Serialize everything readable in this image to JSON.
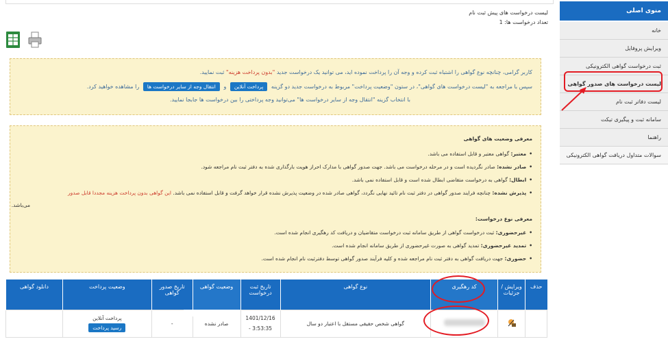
{
  "sidebar": {
    "header": "منوی اصلی",
    "items": [
      "خانه",
      "ویرایش پروفایل",
      "ثبت درخواست گواهی الکترونیکی",
      "لیست درخواست های صدور گواهی",
      "لیست دفاتر ثبت نام",
      "سامانه ثبت و پیگیری تیکت",
      "راهنما",
      "سوالات متداول دریافت گواهی الکترونیکی"
    ]
  },
  "page": {
    "title": "لیست درخواست های پیش ثبت نام",
    "count": "تعداد درخواست ها: 1"
  },
  "tools": {
    "excel_icon": "excel-icon",
    "print_icon": "printer-icon"
  },
  "notice": {
    "line1_a": "کاربر گرامی، چنانچه نوع گواهی را اشتباه ثبت کرده و وجه آن را پرداخت نموده اید، می توانید یک درخواست جدید",
    "line1_b": "\"بدون پرداخت هزینه\"",
    "line1_c": "ثبت نمایید.",
    "line2_a": "سپس با مراجعه به \"لیست درخواست های گواهی\"، در ستون \"وضعیت پرداخت\" مربوط به درخواست جدید دو گزینه",
    "btn_pay": "پرداخت آنلاین",
    "and": "و",
    "btn_transfer": "انتقال وجه از سایر درخواست ها",
    "line2_b": "را مشاهده خواهید کرد.",
    "line3": "با انتخاب گزینه \"انتقال وجه از سایر درخواست ها\" می‌توانید وجه پرداختی را بین درخواست ها جابجا نمایید."
  },
  "legend": {
    "title": "معرفی وضعیت های گواهی",
    "s1_t": "معتبر:",
    "s1": "گواهی معتبر و قابل استفاده می باشد.",
    "s2_t": "صادر نشده:",
    "s2": "صادر نگردیده است و در مرحله درخواست می باشد. جهت صدور گواهی با مدارک احراز هویت بارگذاری شده به دفتر ثبت نام مراجعه شود.",
    "s3_t": "ابطال:",
    "s3": "گواهی به درخواست متقاضی ابطال شده است و قابل استفاده نمی باشد.",
    "s4_t": "پذیرش نشده:",
    "s4": "چنانچه فرایند صدور گواهی در دفتر ثبت نام تائید نهایی نگردد، گواهی صادر شده در وضعیت پذیرش نشده قرار خواهد گرفت و قابل استفاده نمی باشد.",
    "s4_red": "این گواهی بدون پرداخت هزینه مجددا قابل صدور",
    "s4_red2": "می‌باشد.",
    "type_title": "معرفی نوع درخواست:",
    "t1_t": "غیرحضوری:",
    "t1": "ثبت درخواست گواهی از طریق سامانه ثبت درخواست متقاضیان و دریافت کد رهگیری انجام شده است.",
    "t2_t": "تمدید غیرحضوری:",
    "t2": "تمدید گواهی به صورت غیرحضوری از طریق سامانه انجام شده است.",
    "t3_t": "حضوری:",
    "t3": "جهت دریافت گواهی به دفتر ثبت نام مراجعه شده و کلیه فرآیند صدور گواهی توسط دفترثبت نام انجام شده است."
  },
  "table": {
    "headers": [
      "حذف",
      "ویرایش / جزئیات",
      "کد رهگیری",
      "نوع گواهی",
      "تاریخ ثبت درخواست",
      "وضعیت گواهی",
      "تاریخ صدور گواهی",
      "وضعیت پرداخت",
      "دانلود گواهی"
    ],
    "row": {
      "cert_type": "گواهی شخص حقیقی مستقل با اعتبار دو سال",
      "date": "1401/12/16",
      "time": "3:53:35 -",
      "status": "صادر نشده",
      "issue_date": "-",
      "payment_status": "پرداخت آنلاین",
      "receipt_btn": "رسید پرداخت"
    }
  }
}
